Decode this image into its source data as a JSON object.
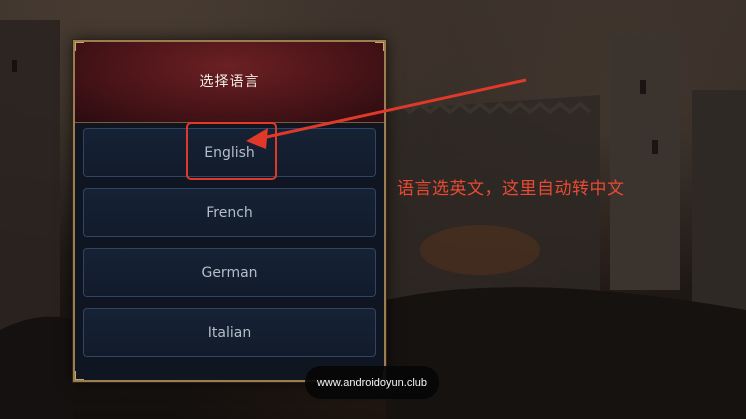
{
  "dialog": {
    "title": "选择语言",
    "options": [
      {
        "label": "English"
      },
      {
        "label": "French"
      },
      {
        "label": "German"
      },
      {
        "label": "Italian"
      }
    ]
  },
  "annotation": {
    "text": "语言选英文，这里自动转中文",
    "color": "#e0392a"
  },
  "watermark": {
    "text": "www.androidoyun.club"
  }
}
